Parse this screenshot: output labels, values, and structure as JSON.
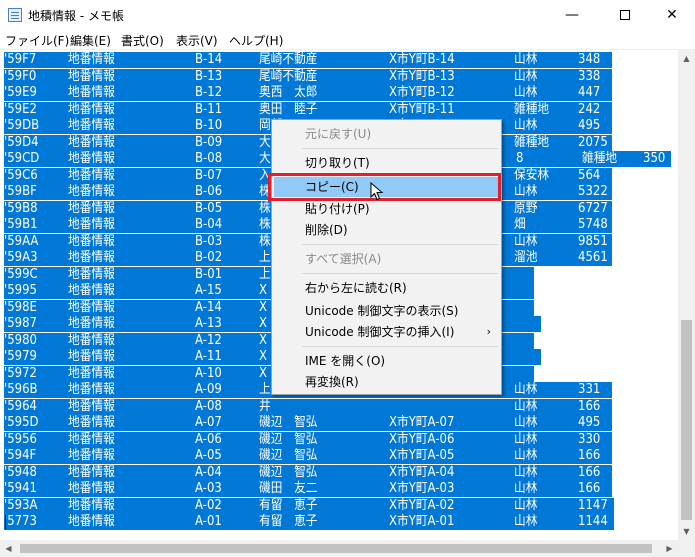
{
  "window": {
    "title": "地積情報 - メモ帳",
    "minimize_label": "—",
    "close_label": "✕"
  },
  "menubar": [
    {
      "label": "ファイル(F)"
    },
    {
      "label": "編集(E)"
    },
    {
      "label": "書式(O)"
    },
    {
      "label": "表示(V)"
    },
    {
      "label": "ヘルプ(H)"
    }
  ],
  "rows": [
    [
      "'59F7",
      "地番情報",
      "B-14",
      "尾崎不動産",
      "X市Y町B-14",
      "山林",
      "348"
    ],
    [
      "'59F0",
      "地番情報",
      "B-13",
      "尾崎不動産",
      "X市Y町B-13",
      "山林",
      "338"
    ],
    [
      "'59E9",
      "地番情報",
      "B-12",
      "奥西　太郎",
      "X市Y町B-12",
      "山林",
      "447"
    ],
    [
      "'59E2",
      "地番情報",
      "B-11",
      "奥田　睦子",
      "X市Y町B-11",
      "雑種地",
      "242"
    ],
    [
      "'59DB",
      "地番情報",
      "B-10",
      "岡部",
      "X市Y町B-10",
      "山林",
      "495"
    ],
    [
      "'59D4",
      "地番情報",
      "B-09",
      "大",
      "",
      "雑種地",
      "2075"
    ],
    [
      "'59CD",
      "地番情報",
      "B-08",
      "大",
      "8",
      "雑種地",
      "350"
    ],
    [
      "'59C6",
      "地番情報",
      "B-07",
      "入",
      "",
      "保安林",
      "564"
    ],
    [
      "'59BF",
      "地番情報",
      "B-06",
      "株",
      "",
      "山林",
      "5322"
    ],
    [
      "'59B8",
      "地番情報",
      "B-05",
      "株",
      "",
      "原野",
      "6727"
    ],
    [
      "'59B1",
      "地番情報",
      "B-04",
      "株",
      "",
      "畑",
      "5748"
    ],
    [
      "'59AA",
      "地番情報",
      "B-03",
      "株",
      "",
      "山林",
      "9851"
    ],
    [
      "'59A3",
      "地番情報",
      "B-02",
      "上",
      "",
      "溜池",
      "4561"
    ],
    [
      "'599C",
      "地番情報",
      "B-01",
      "上",
      "",
      "",
      "47"
    ],
    [
      "'5995",
      "地番情報",
      "A-15",
      "X",
      "",
      "",
      "59"
    ],
    [
      "'598E",
      "地番情報",
      "A-14",
      "X",
      "",
      "",
      "63"
    ],
    [
      "'5987",
      "地番情報",
      "A-13",
      "X",
      "",
      "",
      "783"
    ],
    [
      "'5980",
      "地番情報",
      "A-12",
      "X",
      "",
      "",
      "72"
    ],
    [
      "'5979",
      "地番情報",
      "A-11",
      "X",
      "",
      "",
      "826"
    ],
    [
      "'5972",
      "地番情報",
      "A-10",
      "X",
      "",
      "",
      "42"
    ],
    [
      "'596B",
      "地番情報",
      "A-09",
      "上",
      "",
      "山林",
      "331"
    ],
    [
      "'5964",
      "地番情報",
      "A-08",
      "井",
      "",
      "山林",
      "166"
    ],
    [
      "'595D",
      "地番情報",
      "A-07",
      "磯辺　智弘",
      "X市Y町A-07",
      "山林",
      "495"
    ],
    [
      "'5956",
      "地番情報",
      "A-06",
      "磯辺　智弘",
      "X市Y町A-06",
      "山林",
      "330"
    ],
    [
      "'594F",
      "地番情報",
      "A-05",
      "磯辺　智弘",
      "X市Y町A-05",
      "山林",
      "166"
    ],
    [
      "'5948",
      "地番情報",
      "A-04",
      "磯辺　智弘",
      "X市Y町A-04",
      "山林",
      "166"
    ],
    [
      "'5941",
      "地番情報",
      "A-03",
      "磯田　友二",
      "X市Y町A-03",
      "山林",
      "166"
    ],
    [
      "'593A",
      "地番情報",
      "A-02",
      "有留　恵子",
      "X市Y町A-02",
      "山林",
      "1147"
    ],
    [
      "'5773",
      "地番情報",
      "A-01",
      "有留　恵子",
      "X市Y町A-01",
      "山林",
      "1144"
    ]
  ],
  "context_menu": {
    "items": [
      {
        "label": "元に戻す(U)",
        "enabled": false
      },
      {
        "label": "切り取り(T)",
        "enabled": true
      },
      {
        "label": "コピー(C)",
        "enabled": true,
        "hovered": true
      },
      {
        "label": "貼り付け(P)",
        "enabled": true
      },
      {
        "label": "削除(D)",
        "enabled": true
      },
      {
        "label": "すべて選択(A)",
        "enabled": false
      },
      {
        "label": "右から左に読む(R)",
        "enabled": true
      },
      {
        "label": "Unicode 制御文字の表示(S)",
        "enabled": true
      },
      {
        "label": "Unicode 制御文字の挿入(I)",
        "enabled": true,
        "submenu": true
      },
      {
        "label": "IME を開く(O)",
        "enabled": true
      },
      {
        "label": "再変換(R)",
        "enabled": true
      }
    ],
    "submenu_arrow": "›"
  },
  "colors": {
    "selection": "#0078d7",
    "menu_hover": "#91c9f7",
    "highlight_box": "#e0202a"
  },
  "icons": {
    "scroll_up": "▲",
    "scroll_down": "▼",
    "scroll_left": "◀",
    "scroll_right": "▶"
  }
}
